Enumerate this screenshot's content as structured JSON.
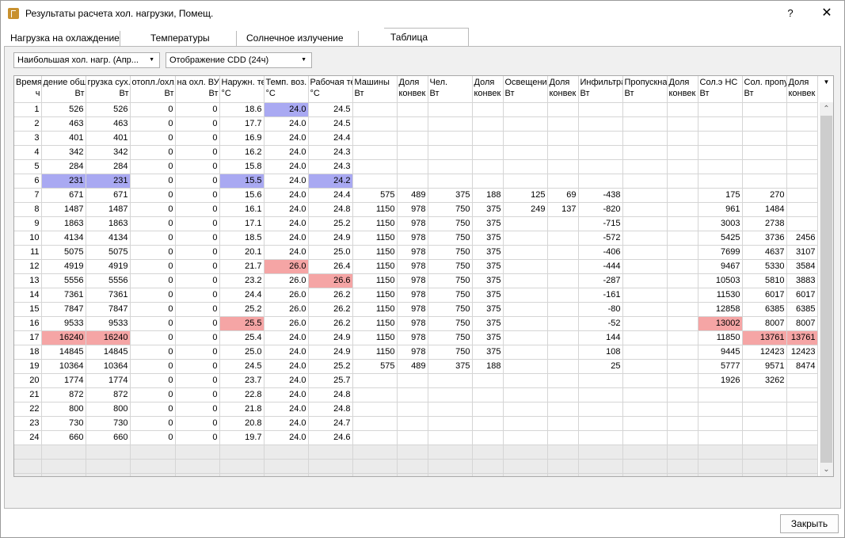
{
  "window": {
    "title": "Результаты расчета хол. нагрузки, Помещ.",
    "help": "?",
    "close": "✕"
  },
  "tabs": [
    {
      "label": "Нагрузка на охлаждение"
    },
    {
      "label": "Температуры"
    },
    {
      "label": "Солнечное излучение"
    },
    {
      "label": "Таблица"
    }
  ],
  "filters": {
    "mode": "Наибольшая хол. нагр. (Апр...",
    "display": "Отображение CDD (24ч)"
  },
  "table": {
    "columns": [
      {
        "name": "Время",
        "unit": "ч"
      },
      {
        "name": "дение общ.",
        "unit": "Вт"
      },
      {
        "name": "грузка сух.",
        "unit": "Вт"
      },
      {
        "name": "отопл./охл.",
        "unit": "Вт"
      },
      {
        "name": "на охл. ВУ",
        "unit": "Вт"
      },
      {
        "name": "Наружн. те",
        "unit": "°C"
      },
      {
        "name": "Темп. воз.",
        "unit": "°C"
      },
      {
        "name": "Рабочая те",
        "unit": "°C"
      },
      {
        "name": "Машины",
        "unit": "Вт"
      },
      {
        "name": "Доля",
        "unit": "конвек"
      },
      {
        "name": "Чел.",
        "unit": "Вт"
      },
      {
        "name": "Доля",
        "unit": "конвек"
      },
      {
        "name": "Освещени",
        "unit": "Вт"
      },
      {
        "name": "Доля",
        "unit": "конвек"
      },
      {
        "name": "Инфильтра",
        "unit": "Вт"
      },
      {
        "name": "Пропускна",
        "unit": "Вт"
      },
      {
        "name": "Доля",
        "unit": "конвек"
      },
      {
        "name": "Сол.э НС",
        "unit": "Вт"
      },
      {
        "name": "Сол. пропу",
        "unit": "Вт"
      },
      {
        "name": "Доля",
        "unit": "конвек"
      }
    ],
    "rows": [
      [
        "1",
        "526",
        "526",
        "0",
        "0",
        "18.6",
        "24.0",
        "24.5",
        "",
        "",
        "",
        "",
        "",
        "",
        "",
        "",
        "",
        "",
        "",
        ""
      ],
      [
        "2",
        "463",
        "463",
        "0",
        "0",
        "17.7",
        "24.0",
        "24.5",
        "",
        "",
        "",
        "",
        "",
        "",
        "",
        "",
        "",
        "",
        "",
        ""
      ],
      [
        "3",
        "401",
        "401",
        "0",
        "0",
        "16.9",
        "24.0",
        "24.4",
        "",
        "",
        "",
        "",
        "",
        "",
        "",
        "",
        "",
        "",
        "",
        ""
      ],
      [
        "4",
        "342",
        "342",
        "0",
        "0",
        "16.2",
        "24.0",
        "24.3",
        "",
        "",
        "",
        "",
        "",
        "",
        "",
        "",
        "",
        "",
        "",
        ""
      ],
      [
        "5",
        "284",
        "284",
        "0",
        "0",
        "15.8",
        "24.0",
        "24.3",
        "",
        "",
        "",
        "",
        "",
        "",
        "",
        "",
        "",
        "",
        "",
        ""
      ],
      [
        "6",
        "231",
        "231",
        "0",
        "0",
        "15.5",
        "24.0",
        "24.2",
        "",
        "",
        "",
        "",
        "",
        "",
        "",
        "",
        "",
        "",
        "",
        ""
      ],
      [
        "7",
        "671",
        "671",
        "0",
        "0",
        "15.6",
        "24.0",
        "24.4",
        "575",
        "489",
        "375",
        "188",
        "125",
        "69",
        "-438",
        "",
        "",
        "175",
        "270",
        ""
      ],
      [
        "8",
        "1487",
        "1487",
        "0",
        "0",
        "16.1",
        "24.0",
        "24.8",
        "1150",
        "978",
        "750",
        "375",
        "249",
        "137",
        "-820",
        "",
        "",
        "961",
        "1484",
        ""
      ],
      [
        "9",
        "1863",
        "1863",
        "0",
        "0",
        "17.1",
        "24.0",
        "25.2",
        "1150",
        "978",
        "750",
        "375",
        "",
        "",
        "-715",
        "",
        "",
        "3003",
        "2738",
        ""
      ],
      [
        "10",
        "4134",
        "4134",
        "0",
        "0",
        "18.5",
        "24.0",
        "24.9",
        "1150",
        "978",
        "750",
        "375",
        "",
        "",
        "-572",
        "",
        "",
        "5425",
        "3736",
        "2456"
      ],
      [
        "11",
        "5075",
        "5075",
        "0",
        "0",
        "20.1",
        "24.0",
        "25.0",
        "1150",
        "978",
        "750",
        "375",
        "",
        "",
        "-406",
        "",
        "",
        "7699",
        "4637",
        "3107"
      ],
      [
        "12",
        "4919",
        "4919",
        "0",
        "0",
        "21.7",
        "26.0",
        "26.4",
        "1150",
        "978",
        "750",
        "375",
        "",
        "",
        "-444",
        "",
        "",
        "9467",
        "5330",
        "3584"
      ],
      [
        "13",
        "5556",
        "5556",
        "0",
        "0",
        "23.2",
        "26.0",
        "26.6",
        "1150",
        "978",
        "750",
        "375",
        "",
        "",
        "-287",
        "",
        "",
        "10503",
        "5810",
        "3883"
      ],
      [
        "14",
        "7361",
        "7361",
        "0",
        "0",
        "24.4",
        "26.0",
        "26.2",
        "1150",
        "978",
        "750",
        "375",
        "",
        "",
        "-161",
        "",
        "",
        "11530",
        "6017",
        "6017"
      ],
      [
        "15",
        "7847",
        "7847",
        "0",
        "0",
        "25.2",
        "26.0",
        "26.2",
        "1150",
        "978",
        "750",
        "375",
        "",
        "",
        "-80",
        "",
        "",
        "12858",
        "6385",
        "6385"
      ],
      [
        "16",
        "9533",
        "9533",
        "0",
        "0",
        "25.5",
        "26.0",
        "26.2",
        "1150",
        "978",
        "750",
        "375",
        "",
        "",
        "-52",
        "",
        "",
        "13002",
        "8007",
        "8007"
      ],
      [
        "17",
        "16240",
        "16240",
        "0",
        "0",
        "25.4",
        "24.0",
        "24.9",
        "1150",
        "978",
        "750",
        "375",
        "",
        "",
        "144",
        "",
        "",
        "11850",
        "13761",
        "13761"
      ],
      [
        "18",
        "14845",
        "14845",
        "0",
        "0",
        "25.0",
        "24.0",
        "24.9",
        "1150",
        "978",
        "750",
        "375",
        "",
        "",
        "108",
        "",
        "",
        "9445",
        "12423",
        "12423"
      ],
      [
        "19",
        "10364",
        "10364",
        "0",
        "0",
        "24.5",
        "24.0",
        "25.2",
        "575",
        "489",
        "375",
        "188",
        "",
        "",
        "25",
        "",
        "",
        "5777",
        "9571",
        "8474"
      ],
      [
        "20",
        "1774",
        "1774",
        "0",
        "0",
        "23.7",
        "24.0",
        "25.7",
        "",
        "",
        "",
        "",
        "",
        "",
        "",
        "",
        "",
        "1926",
        "3262",
        ""
      ],
      [
        "21",
        "872",
        "872",
        "0",
        "0",
        "22.8",
        "24.0",
        "24.8",
        "",
        "",
        "",
        "",
        "",
        "",
        "",
        "",
        "",
        "",
        "",
        ""
      ],
      [
        "22",
        "800",
        "800",
        "0",
        "0",
        "21.8",
        "24.0",
        "24.8",
        "",
        "",
        "",
        "",
        "",
        "",
        "",
        "",
        "",
        "",
        "",
        ""
      ],
      [
        "23",
        "730",
        "730",
        "0",
        "0",
        "20.8",
        "24.0",
        "24.7",
        "",
        "",
        "",
        "",
        "",
        "",
        "",
        "",
        "",
        "",
        "",
        ""
      ],
      [
        "24",
        "660",
        "660",
        "0",
        "0",
        "19.7",
        "24.0",
        "24.6",
        "",
        "",
        "",
        "",
        "",
        "",
        "",
        "",
        "",
        "",
        "",
        ""
      ]
    ],
    "highlights": [
      {
        "row": 0,
        "col": 6,
        "color": "blue"
      },
      {
        "row": 5,
        "col": 1,
        "color": "blue"
      },
      {
        "row": 5,
        "col": 2,
        "color": "blue"
      },
      {
        "row": 5,
        "col": 5,
        "color": "blue"
      },
      {
        "row": 5,
        "col": 7,
        "color": "blue"
      },
      {
        "row": 11,
        "col": 6,
        "color": "red"
      },
      {
        "row": 12,
        "col": 7,
        "color": "red"
      },
      {
        "row": 15,
        "col": 5,
        "color": "red"
      },
      {
        "row": 15,
        "col": 17,
        "color": "red"
      },
      {
        "row": 16,
        "col": 1,
        "color": "red"
      },
      {
        "row": 16,
        "col": 2,
        "color": "red"
      },
      {
        "row": 16,
        "col": 18,
        "color": "red"
      },
      {
        "row": 16,
        "col": 19,
        "color": "red"
      }
    ],
    "colors": {
      "blue": "#a9a9f2",
      "red": "#f5a5a5"
    }
  },
  "buttons": {
    "close": "Закрыть"
  }
}
